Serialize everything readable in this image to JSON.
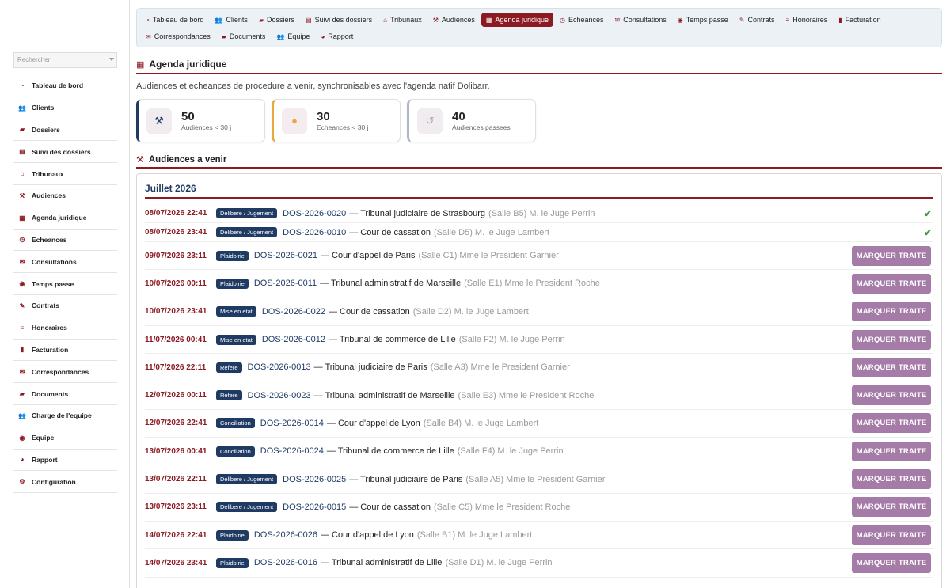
{
  "sidebar": {
    "search_placeholder": "Rechercher",
    "items": [
      {
        "label": "Tableau de bord",
        "icon": "gauge-icon"
      },
      {
        "label": "Clients",
        "icon": "users-icon"
      },
      {
        "label": "Dossiers",
        "icon": "folder-icon"
      },
      {
        "label": "Suivi des dossiers",
        "icon": "table-icon"
      },
      {
        "label": "Tribunaux",
        "icon": "building-icon"
      },
      {
        "label": "Audiences",
        "icon": "gavel-icon"
      },
      {
        "label": "Agenda juridique",
        "icon": "calendar-icon"
      },
      {
        "label": "Echeances",
        "icon": "clock-icon"
      },
      {
        "label": "Consultations",
        "icon": "comments-icon"
      },
      {
        "label": "Temps passe",
        "icon": "user-clock-icon"
      },
      {
        "label": "Contrats",
        "icon": "file-signature-icon"
      },
      {
        "label": "Honoraires",
        "icon": "coins-icon"
      },
      {
        "label": "Facturation",
        "icon": "invoice-icon"
      },
      {
        "label": "Correspondances",
        "icon": "envelope-icon"
      },
      {
        "label": "Documents",
        "icon": "folder-open-icon"
      },
      {
        "label": "Charge de l'equipe",
        "icon": "users-cog-icon"
      },
      {
        "label": "Equipe",
        "icon": "user-icon"
      },
      {
        "label": "Rapport",
        "icon": "chart-pie-icon"
      },
      {
        "label": "Configuration",
        "icon": "gear-icon"
      }
    ]
  },
  "topnav": {
    "row1": [
      {
        "label": "Tableau de bord",
        "icon": "gauge-icon",
        "glyph": "◔"
      },
      {
        "label": "Clients",
        "icon": "users-icon",
        "glyph": "👥"
      },
      {
        "label": "Dossiers",
        "icon": "folder-icon",
        "glyph": "▰"
      },
      {
        "label": "Suivi des dossiers",
        "icon": "table-icon",
        "glyph": "▤"
      },
      {
        "label": "Tribunaux",
        "icon": "building-icon",
        "glyph": "⌂"
      },
      {
        "label": "Audiences",
        "icon": "gavel-icon",
        "glyph": "⚒"
      },
      {
        "label": "Agenda juridique",
        "icon": "calendar-icon",
        "glyph": "▦",
        "active": true
      },
      {
        "label": "Echeances",
        "icon": "clock-icon",
        "glyph": "◷"
      },
      {
        "label": "Consultations",
        "icon": "comments-icon",
        "glyph": "✉"
      },
      {
        "label": "Temps passe",
        "icon": "user-clock-icon",
        "glyph": "◉"
      },
      {
        "label": "Contrats",
        "icon": "file-signature-icon",
        "glyph": "✎"
      },
      {
        "label": "Honoraires",
        "icon": "coins-icon",
        "glyph": "≡"
      },
      {
        "label": "Facturation",
        "icon": "invoice-icon",
        "glyph": "▮"
      }
    ],
    "row2": [
      {
        "label": "Correspondances",
        "icon": "envelope-icon",
        "glyph": "✉"
      },
      {
        "label": "Documents",
        "icon": "folder-open-icon",
        "glyph": "▰"
      },
      {
        "label": "Equipe",
        "icon": "users-icon",
        "glyph": "👥"
      },
      {
        "label": "Rapport",
        "icon": "chart-pie-icon",
        "glyph": "◕"
      }
    ]
  },
  "main": {
    "title": "Agenda juridique",
    "subtitle": "Audiences et echeances de procedure a venir, synchronisables avec l'agenda natif Dolibarr.",
    "stats": [
      {
        "value": "50",
        "label": "Audiences < 30 j",
        "icon": "gavel-icon",
        "accent": "#1f3b64"
      },
      {
        "value": "30",
        "label": "Echeances < 30 j",
        "icon": "clock-icon",
        "accent": "#e8a93a"
      },
      {
        "value": "40",
        "label": "Audiences passees",
        "icon": "history-icon",
        "accent": "#b0b8c4"
      }
    ],
    "section_title": "Audiences a venir",
    "month": "Juillet 2026",
    "button_label": "MARQUER TRAITE",
    "rows": [
      {
        "date": "08/07/2026 22:41",
        "type": "Delibere / Jugement",
        "ref": "DOS-2026-0020",
        "court": "— Tribunal judiciaire de Strasbourg",
        "room": "(Salle B5) M. le Juge Perrin",
        "done": true
      },
      {
        "date": "08/07/2026 23:41",
        "type": "Delibere / Jugement",
        "ref": "DOS-2026-0010",
        "court": "— Cour de cassation",
        "room": "(Salle D5) M. le Juge Lambert",
        "done": true
      },
      {
        "date": "09/07/2026 23:11",
        "type": "Plaidoirie",
        "ref": "DOS-2026-0021",
        "court": "— Cour d'appel de Paris",
        "room": "(Salle C1) Mme le President Garnier",
        "done": false
      },
      {
        "date": "10/07/2026 00:11",
        "type": "Plaidoirie",
        "ref": "DOS-2026-0011",
        "court": "— Tribunal administratif de Marseille",
        "room": "(Salle E1) Mme le President Roche",
        "done": false
      },
      {
        "date": "10/07/2026 23:41",
        "type": "Mise en etat",
        "ref": "DOS-2026-0022",
        "court": "— Cour de cassation",
        "room": "(Salle D2) M. le Juge Lambert",
        "done": false
      },
      {
        "date": "11/07/2026 00:41",
        "type": "Mise en etat",
        "ref": "DOS-2026-0012",
        "court": "— Tribunal de commerce de Lille",
        "room": "(Salle F2) M. le Juge Perrin",
        "done": false
      },
      {
        "date": "11/07/2026 22:11",
        "type": "Refere",
        "ref": "DOS-2026-0013",
        "court": "— Tribunal judiciaire de Paris",
        "room": "(Salle A3) Mme le President Garnier",
        "done": false
      },
      {
        "date": "12/07/2026 00:11",
        "type": "Refere",
        "ref": "DOS-2026-0023",
        "court": "— Tribunal administratif de Marseille",
        "room": "(Salle E3) Mme le President Roche",
        "done": false
      },
      {
        "date": "12/07/2026 22:41",
        "type": "Conciliation",
        "ref": "DOS-2026-0014",
        "court": "— Cour d'appel de Lyon",
        "room": "(Salle B4) M. le Juge Lambert",
        "done": false
      },
      {
        "date": "13/07/2026 00:41",
        "type": "Conciliation",
        "ref": "DOS-2026-0024",
        "court": "— Tribunal de commerce de Lille",
        "room": "(Salle F4) M. le Juge Perrin",
        "done": false
      },
      {
        "date": "13/07/2026 22:11",
        "type": "Delibere / Jugement",
        "ref": "DOS-2026-0025",
        "court": "— Tribunal judiciaire de Paris",
        "room": "(Salle A5) Mme le President Garnier",
        "done": false
      },
      {
        "date": "13/07/2026 23:11",
        "type": "Delibere / Jugement",
        "ref": "DOS-2026-0015",
        "court": "— Cour de cassation",
        "room": "(Salle C5) Mme le President Roche",
        "done": false
      },
      {
        "date": "14/07/2026 22:41",
        "type": "Plaidoirie",
        "ref": "DOS-2026-0026",
        "court": "— Cour d'appel de Lyon",
        "room": "(Salle B1) M. le Juge Lambert",
        "done": false
      },
      {
        "date": "14/07/2026 23:41",
        "type": "Plaidoirie",
        "ref": "DOS-2026-0016",
        "court": "— Tribunal administratif de Lille",
        "room": "(Salle D1) M. le Juge Perrin",
        "done": false
      }
    ]
  },
  "colors": {
    "brand": "#8b1a22",
    "navy": "#1f3b64",
    "button": "#a57ba8",
    "check": "#3a9a3a"
  }
}
